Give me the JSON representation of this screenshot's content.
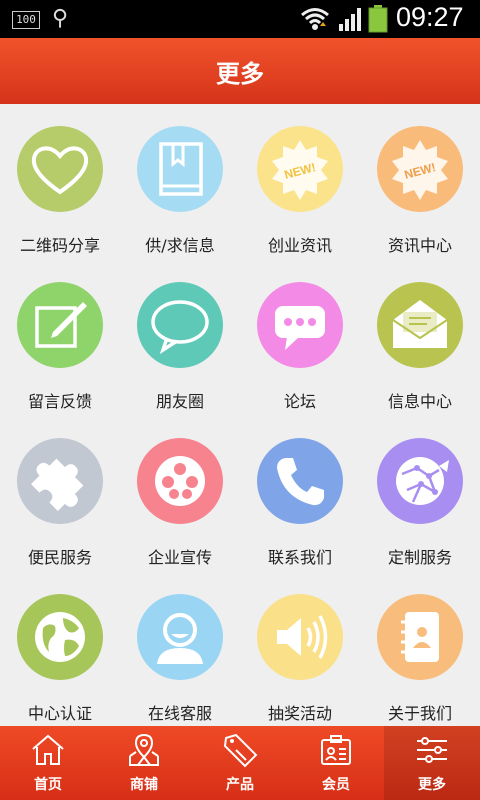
{
  "status_bar": {
    "battery_label": "100",
    "time": "09:27"
  },
  "header": {
    "title": "更多"
  },
  "grid": [
    {
      "label": "二维码分享",
      "icon": "heart-icon",
      "color": "#b6cc6a"
    },
    {
      "label": "供/求信息",
      "icon": "book-icon",
      "color": "#a6dcf3"
    },
    {
      "label": "创业资讯",
      "icon": "new-badge-icon",
      "color": "#fbe38c"
    },
    {
      "label": "资讯中心",
      "icon": "new-badge-icon",
      "color": "#f9bb7a"
    },
    {
      "label": "留言反馈",
      "icon": "edit-icon",
      "color": "#8fd36b"
    },
    {
      "label": "朋友圈",
      "icon": "chat-bubble-icon",
      "color": "#5ec9b7"
    },
    {
      "label": "论坛",
      "icon": "message-dots-icon",
      "color": "#f38be6"
    },
    {
      "label": "信息中心",
      "icon": "envelope-icon",
      "color": "#b8c44f"
    },
    {
      "label": "便民服务",
      "icon": "puzzle-icon",
      "color": "#c2c8d2"
    },
    {
      "label": "企业宣传",
      "icon": "film-reel-icon",
      "color": "#f7838f"
    },
    {
      "label": "联系我们",
      "icon": "phone-icon",
      "color": "#7fa5e8"
    },
    {
      "label": "定制服务",
      "icon": "globe-network-icon",
      "color": "#a88ef0"
    },
    {
      "label": "中心认证",
      "icon": "globe-icon",
      "color": "#a7c65a"
    },
    {
      "label": "在线客服",
      "icon": "customer-service-icon",
      "color": "#9ad6f4"
    },
    {
      "label": "抽奖活动",
      "icon": "speaker-icon",
      "color": "#fbe08a"
    },
    {
      "label": "关于我们",
      "icon": "contacts-book-icon",
      "color": "#f8bd7c"
    }
  ],
  "tab_bar": [
    {
      "label": "首页",
      "icon": "home-icon"
    },
    {
      "label": "商铺",
      "icon": "shop-icon"
    },
    {
      "label": "产品",
      "icon": "tag-icon"
    },
    {
      "label": "会员",
      "icon": "member-card-icon"
    },
    {
      "label": "更多",
      "icon": "settings-sliders-icon",
      "active": true
    }
  ]
}
